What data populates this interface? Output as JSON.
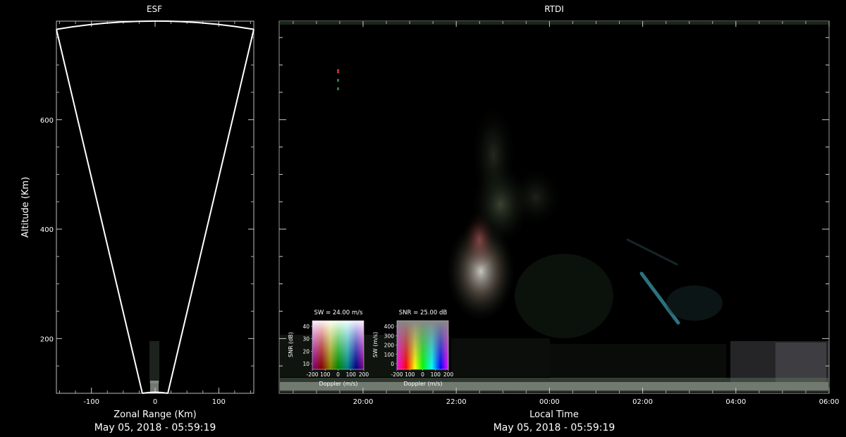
{
  "esf": {
    "title": "ESF",
    "xlabel": "Zonal Range (Km)",
    "ylabel": "Altitude (Km)",
    "timestamp": "May 05, 2018 - 05:59:19",
    "xticks": [
      -100,
      0,
      100
    ],
    "yticks": [
      200,
      400,
      600
    ],
    "xlim": [
      -155,
      155
    ],
    "ylim": [
      100,
      780
    ],
    "fan": {
      "apex_x": 0,
      "apex_alt": 100,
      "top_left_x": -155,
      "top_right_x": 155,
      "top_alt": 765,
      "arc_peak_alt": 780
    }
  },
  "rtdi": {
    "title": "RTDI",
    "xlabel": "Local Time",
    "timestamp": "May 05, 2018 - 05:59:19",
    "xticks": [
      "20:00",
      "22:00",
      "00:00",
      "02:00",
      "04:00",
      "06:00"
    ],
    "xlim_hours": [
      18.2,
      30.0
    ],
    "ylim": [
      100,
      780
    ]
  },
  "colorbars": [
    {
      "title": "SW = 24.00 m/s",
      "xlabel": "Doppler (m/s)",
      "ylabel": "SNR (dB)",
      "xticks": [
        "-200",
        "100",
        "0",
        "100",
        "200"
      ],
      "yticks": [
        "10",
        "20",
        "30",
        "40"
      ]
    },
    {
      "title": "SNR = 25.00 dB",
      "xlabel": "Doppler (m/s)",
      "ylabel": "SW (m/s)",
      "xticks": [
        "-200",
        "100",
        "0",
        "100",
        "200"
      ],
      "yticks": [
        "0",
        "100",
        "200",
        "300",
        "400"
      ]
    }
  ],
  "chart_data": [
    {
      "type": "line",
      "title": "ESF",
      "xlabel": "Zonal Range (Km)",
      "ylabel": "Altitude (Km)",
      "xlim": [
        -155,
        155
      ],
      "ylim": [
        100,
        780
      ],
      "series": [
        {
          "x": [
            -155,
            0,
            155
          ],
          "y": [
            765,
            100,
            765
          ]
        }
      ]
    },
    {
      "type": "heatmap",
      "title": "RTDI",
      "xlabel": "Local Time",
      "ylabel": "",
      "x_ticks": [
        "20:00",
        "22:00",
        "00:00",
        "02:00",
        "04:00",
        "06:00"
      ],
      "ylim": [
        100,
        780
      ],
      "features": [
        {
          "time_h": 22.8,
          "alt_low": 250,
          "alt_high": 520,
          "note": "plume"
        },
        {
          "time_h": 26.6,
          "alt_low": 230,
          "alt_high": 300,
          "note": "streak"
        }
      ]
    }
  ]
}
